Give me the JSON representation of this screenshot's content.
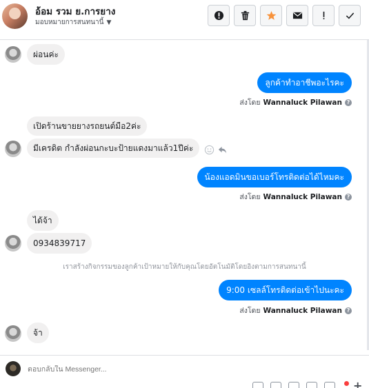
{
  "header": {
    "name": "อ้อม รวม ย.การยาง",
    "assign_label": "มอบหมายการสนทนานี้"
  },
  "toolbar": {
    "buttons": [
      "alert-circle-icon",
      "trash-icon",
      "star-icon",
      "envelope-icon",
      "exclamation-icon",
      "check-icon"
    ],
    "star_color": "#f7923b"
  },
  "messages": [
    {
      "from": "customer",
      "text": "ผ่อนค่ะ"
    },
    {
      "from": "page",
      "text": "ลูกค้าทำอาชีพอะไรคะ",
      "sent_by_prefix": "ส่งโดย",
      "sent_by_name": "Wannaluck Pilawan"
    },
    {
      "from": "customer",
      "text": "เปิดร้านขายยางรถยนต์มือ2ค่ะ"
    },
    {
      "from": "customer",
      "text": "มีเครดิต กำลังผ่อนกะบะป้ายแดงมาแล้ว1ปีค่ะ"
    },
    {
      "from": "page",
      "text": "น้องแอดมินขอเบอร์โทรติดต่อได้ไหมคะ",
      "sent_by_prefix": "ส่งโดย",
      "sent_by_name": "Wannaluck Pilawan"
    },
    {
      "from": "customer",
      "text": "ได้จ้า"
    },
    {
      "from": "customer",
      "text": "0934839717"
    },
    {
      "from": "system",
      "text": "เราสร้างกิจกรรมของลูกค้าเป้าหมายให้กับคุณโดยอัตโนมัติโดยอิงตามการสนทนานี้"
    },
    {
      "from": "page",
      "text": "9:00 เซลล์โทรติดต่อเข้าไปนะคะ",
      "sent_by_prefix": "ส่งโดย",
      "sent_by_name": "Wannaluck Pilawan"
    },
    {
      "from": "customer",
      "text": "จ้า"
    }
  ],
  "composer": {
    "placeholder": "ตอบกลับใน Messenger..."
  },
  "colors": {
    "outgoing_bubble": "#0084ff",
    "incoming_bubble": "#f1f0f0"
  }
}
